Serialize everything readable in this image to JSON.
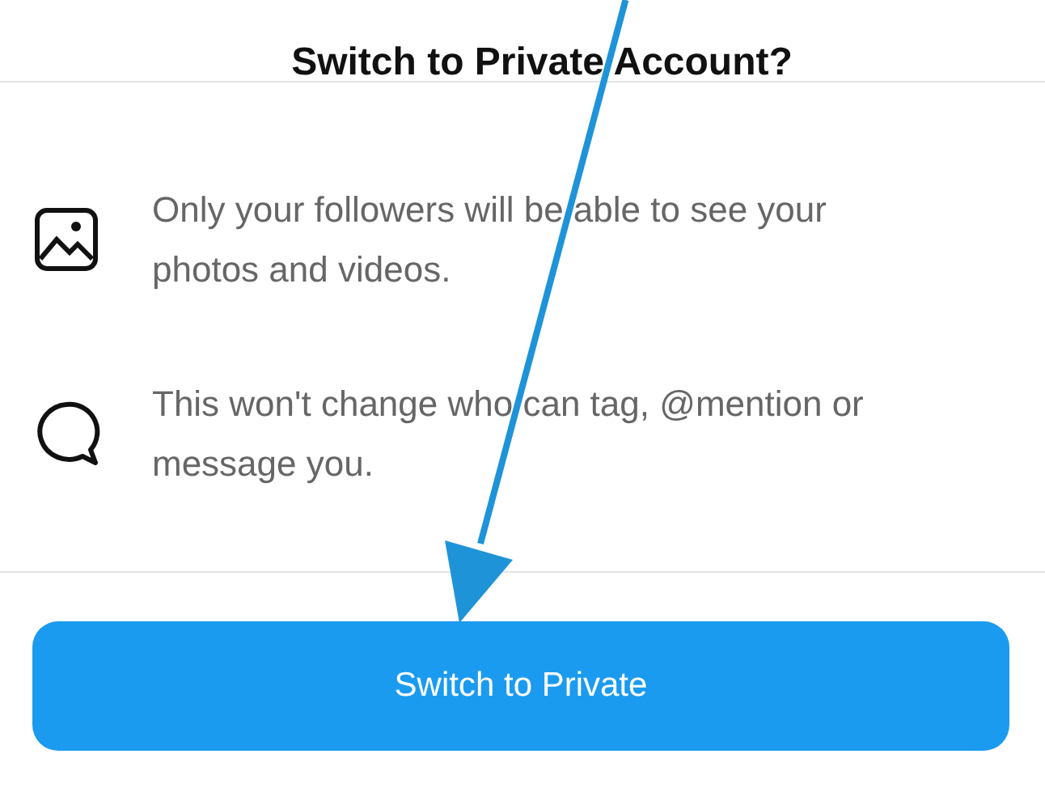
{
  "dialog": {
    "title": "Switch to Private Account?",
    "items": [
      {
        "kind": "photo",
        "text": "Only your followers will be able to see your photos and videos."
      },
      {
        "kind": "message",
        "text": "This won't change who can tag, @mention or message you."
      }
    ],
    "button": "Switch to Private"
  }
}
